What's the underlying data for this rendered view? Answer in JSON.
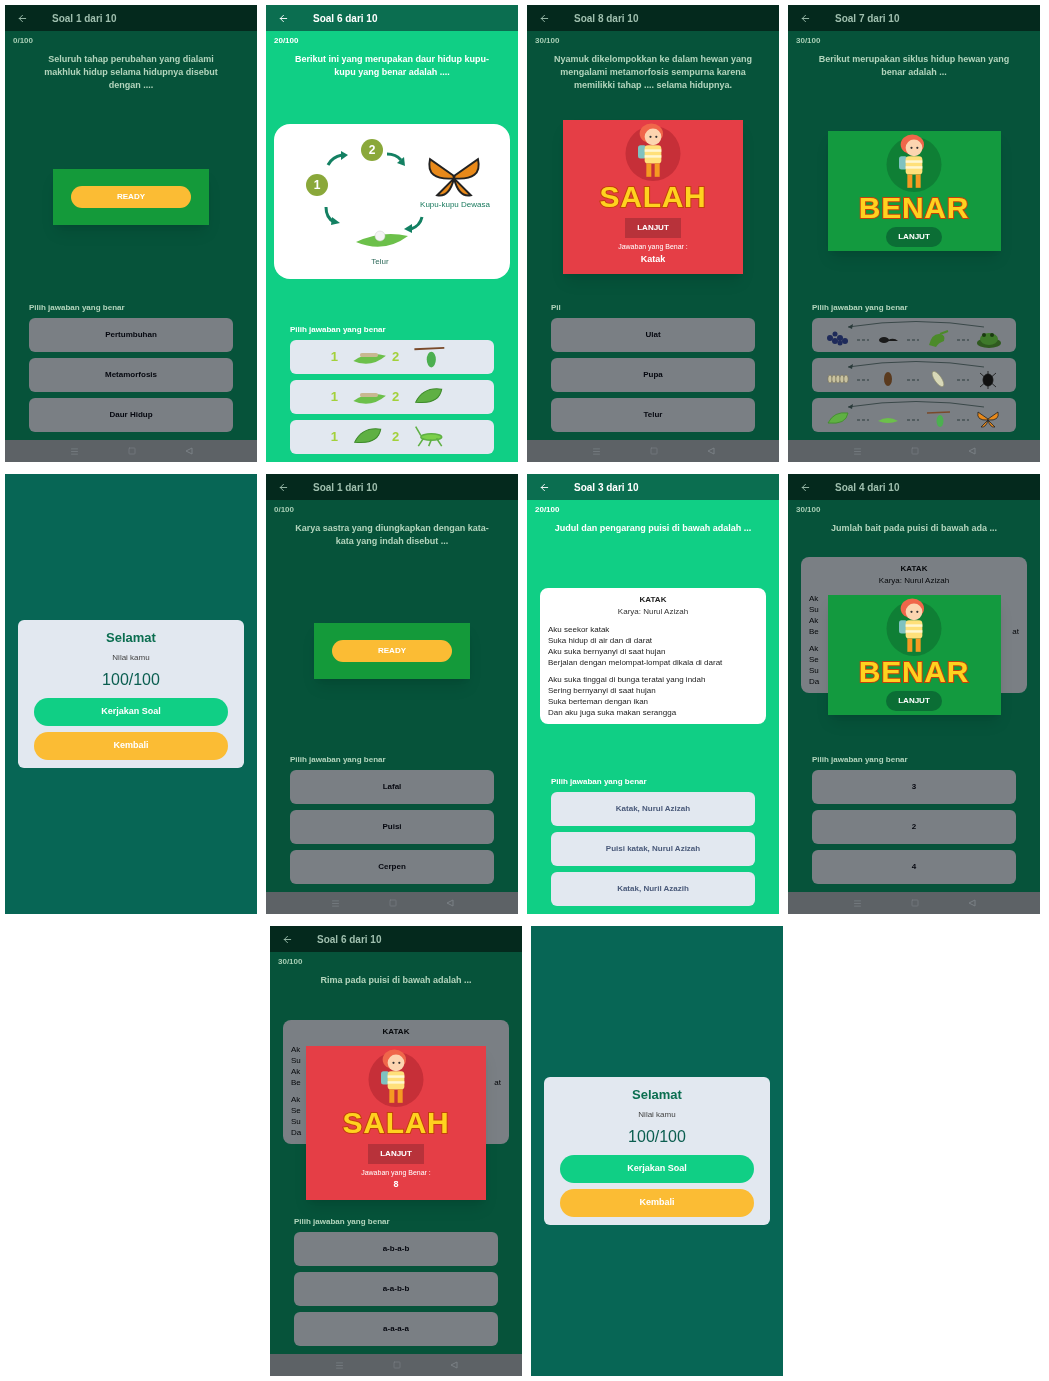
{
  "screens": [
    {
      "kind": "quiz",
      "dimmed": true,
      "nav_bar": true,
      "title": "Soal 1 dari 10",
      "score": "0/100",
      "question": "Seluruh tahap perubahan yang dialami makhluk hidup selama hidupnya disebut dengan ....",
      "popup": {
        "kind": "ready",
        "button": "READY"
      },
      "prompt": "Pilih jawaban yang benar",
      "answers": [
        {
          "kind": "text",
          "text": "Pertumbuhan"
        },
        {
          "kind": "text",
          "text": "Metamorfosis"
        },
        {
          "kind": "text",
          "text": "Daur Hidup"
        }
      ]
    },
    {
      "kind": "quiz",
      "dimmed": false,
      "nav_bar": false,
      "title": "Soal 6 dari 10",
      "score": "20/100",
      "question": "Berikut ini yang merupakan daur hidup kupu-kupu yang benar adalah ....",
      "diagram": {
        "steps": [
          "1",
          "2"
        ],
        "adult_label": "Kupu-kupu Dewasa",
        "egg_label": "Telur"
      },
      "prompt": "Pilih jawaban yang benar",
      "answers": [
        {
          "kind": "stage_pair",
          "labels": [
            "1",
            "2"
          ],
          "pictures": [
            {
              "kind": "larva_leaf"
            },
            {
              "kind": "chrysalis"
            }
          ]
        },
        {
          "kind": "stage_pair",
          "labels": [
            "1",
            "2"
          ],
          "pictures": [
            {
              "kind": "larva_leaf"
            },
            {
              "kind": "leaf"
            }
          ]
        },
        {
          "kind": "stage_pair",
          "labels": [
            "1",
            "2"
          ],
          "pictures": [
            {
              "kind": "leaf"
            },
            {
              "kind": "grasshopper"
            }
          ]
        }
      ]
    },
    {
      "kind": "quiz",
      "dimmed": true,
      "nav_bar": true,
      "title": "Soal 8 dari 10",
      "score": "30/100",
      "question": "Nyamuk dikelompokkan ke dalam hewan yang mengalami metamorfosis sempurna karena memilikki tahap .... selama hidupnya.",
      "popup": {
        "kind": "salah",
        "word": "SALAH",
        "button": "LANJUT",
        "caption": "Jawaban yang Benar :",
        "answer": "Katak"
      },
      "prompt": "Pil",
      "answers": [
        {
          "kind": "text",
          "text": "Ulat"
        },
        {
          "kind": "text",
          "text": "Pupa"
        },
        {
          "kind": "text",
          "text": "Telur"
        }
      ]
    },
    {
      "kind": "quiz",
      "dimmed": true,
      "nav_bar": true,
      "title": "Soal 7 dari 10",
      "score": "30/100",
      "question": "Berikut merupakan siklus hidup hewan yang benar adalah ...",
      "popup": {
        "kind": "benar",
        "word": "BENAR",
        "button": "LANJUT"
      },
      "prompt": "Pilih jawaban yang benar",
      "answers": [
        {
          "kind": "cycle",
          "pictures": [
            {
              "kind": "eggs"
            },
            {
              "kind": "tadpole"
            },
            {
              "kind": "froglet"
            },
            {
              "kind": "frog"
            }
          ]
        },
        {
          "kind": "cycle",
          "pictures": [
            {
              "kind": "eggs_pale"
            },
            {
              "kind": "pupa"
            },
            {
              "kind": "larva"
            },
            {
              "kind": "fly"
            }
          ]
        },
        {
          "kind": "cycle",
          "pictures": [
            {
              "kind": "leaf"
            },
            {
              "kind": "caterpillar"
            },
            {
              "kind": "chrysalis"
            },
            {
              "kind": "butterfly"
            }
          ]
        }
      ]
    },
    {
      "kind": "result",
      "title": "Selamat",
      "label": "Nilai kamu",
      "score": "100/100",
      "buttons": [
        "Kerjakan Soal",
        "Kembali"
      ]
    },
    {
      "kind": "quiz",
      "dimmed": true,
      "nav_bar": true,
      "title": "Soal 1 dari 10",
      "score": "0/100",
      "question": "Karya sastra yang diungkapkan dengan kata-kata yang indah disebut ...",
      "popup": {
        "kind": "ready",
        "button": "READY"
      },
      "prompt": "Pilih jawaban yang benar",
      "answers": [
        {
          "kind": "text",
          "text": "Lafal"
        },
        {
          "kind": "text",
          "text": "Puisi"
        },
        {
          "kind": "text",
          "text": "Cerpen"
        }
      ]
    },
    {
      "kind": "quiz",
      "dimmed": false,
      "nav_bar": false,
      "title": "Soal 3 dari 10",
      "score": "20/100",
      "question": "Judul dan pengarang puisi di bawah adalah ...",
      "poem": {
        "title": "KATAK",
        "author": "Karya: Nurul Azizah",
        "stanzas": [
          [
            {
              "text": "Aku seekor katak"
            },
            {
              "text": "Suka hidup di air dan di darat"
            },
            {
              "text": "Aku suka bernyanyi di saat hujan"
            },
            {
              "text": "Berjalan dengan melompat-lompat dikala di darat"
            }
          ],
          [
            {
              "text": "Aku suka tinggal di bunga teratai yang indah"
            },
            {
              "text": "Sering bernyanyi di saat hujan"
            },
            {
              "text": "Suka berteman dengan ikan"
            },
            {
              "text": "Dan aku juga suka makan serangga"
            }
          ]
        ]
      },
      "prompt": "Pilih jawaban yang benar",
      "answers": [
        {
          "kind": "text",
          "text": "Katak, Nurul Azizah"
        },
        {
          "kind": "text",
          "text": "Puisi katak, Nurul Azizah"
        },
        {
          "kind": "text",
          "text": "Katak, Nuril Azazih"
        }
      ]
    },
    {
      "kind": "quiz",
      "dimmed": true,
      "nav_bar": true,
      "title": "Soal 4 dari 10",
      "score": "30/100",
      "question": "Jumlah bait pada puisi di bawah ada ...",
      "poem": {
        "title": "KATAK",
        "author": "Karya: Nurul Azizah",
        "stanzas": [
          [
            {
              "start": "Ak"
            },
            {
              "start": "Su"
            },
            {
              "start": "Ak"
            },
            {
              "start": "Be",
              "end": "at"
            }
          ],
          [
            {
              "start": "Ak"
            },
            {
              "start": "Se"
            },
            {
              "start": "Su"
            },
            {
              "start": "Da"
            }
          ]
        ]
      },
      "popup": {
        "kind": "benar",
        "word": "BENAR",
        "button": "LANJUT"
      },
      "prompt": "Pilih jawaban yang benar",
      "answers": [
        {
          "kind": "text",
          "text": "3"
        },
        {
          "kind": "text",
          "text": "2"
        },
        {
          "kind": "text",
          "text": "4"
        }
      ]
    },
    {
      "kind": "quiz",
      "dimmed": true,
      "nav_bar": true,
      "title": "Soal 6 dari 10",
      "score": "30/100",
      "question": "Rima pada puisi di bawah adalah ...",
      "poem": {
        "title": "KATAK",
        "stanzas": [
          [
            {
              "start": "Ak"
            },
            {
              "start": "Su"
            },
            {
              "start": "Ak"
            },
            {
              "start": "Be",
              "end": "at"
            }
          ],
          [
            {
              "start": "Ak"
            },
            {
              "start": "Se"
            },
            {
              "start": "Su"
            },
            {
              "start": "Da"
            }
          ]
        ]
      },
      "popup": {
        "kind": "salah",
        "word": "SALAH",
        "button": "LANJUT",
        "caption": "Jawaban yang Benar :",
        "answer": "8"
      },
      "prompt": "Pilih jawaban yang benar",
      "answers": [
        {
          "kind": "text",
          "text": "a-b-a-b"
        },
        {
          "kind": "text",
          "text": "a-a-b-b"
        },
        {
          "kind": "text",
          "text": "a-a-a-a"
        }
      ]
    },
    {
      "kind": "result",
      "title": "Selamat",
      "label": "Nilai kamu",
      "score": "100/100",
      "buttons": [
        "Kerjakan Soal",
        "Kembali"
      ]
    }
  ]
}
